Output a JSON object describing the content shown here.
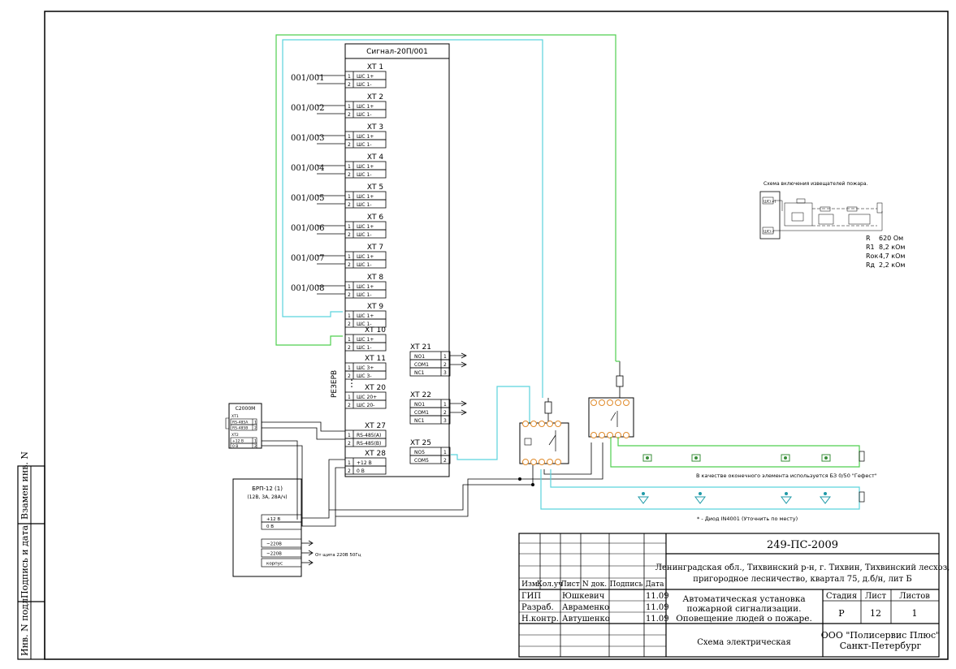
{
  "panel": {
    "title": "Сигнал-20П/001",
    "reserve_label": "РЕЗЕРВ",
    "pin1_label": "1",
    "pin2_label": "2",
    "ellipsis": "⋮",
    "blocks": [
      {
        "header": "ХТ 1",
        "zone": "001/001",
        "labels": [
          "ШС 1+",
          "ШС 1-"
        ]
      },
      {
        "header": "ХТ 2",
        "zone": "001/002",
        "labels": [
          "ШС 1+",
          "ШС 1-"
        ]
      },
      {
        "header": "ХТ 3",
        "zone": "001/003",
        "labels": [
          "ШС 1+",
          "ШС 1-"
        ]
      },
      {
        "header": "ХТ 4",
        "zone": "001/004",
        "labels": [
          "ШС 1+",
          "ШС 1-"
        ]
      },
      {
        "header": "ХТ 5",
        "zone": "001/005",
        "labels": [
          "ШС 1+",
          "ШС 1-"
        ]
      },
      {
        "header": "ХТ 6",
        "zone": "001/006",
        "labels": [
          "ШС 1+",
          "ШС 1-"
        ]
      },
      {
        "header": "ХТ 7",
        "zone": "001/007",
        "labels": [
          "ШС 1+",
          "ШС 1-"
        ]
      },
      {
        "header": "ХТ 8",
        "zone": "001/008",
        "labels": [
          "ШС 1+",
          "ШС 1-"
        ]
      },
      {
        "header": "ХТ 9",
        "zone": "",
        "labels": [
          "ШС 1+",
          "ШС 1-"
        ]
      },
      {
        "header": "ХТ 10",
        "zone": "",
        "labels": [
          "ШС 1+",
          "ШС 1-"
        ]
      },
      {
        "header": "ХТ 11",
        "zone": "",
        "labels": [
          "ШС 3+",
          "ШС 3-"
        ]
      },
      {
        "header": "ХТ 20",
        "zone": "",
        "labels": [
          "ШС 20+",
          "ШС 20-"
        ]
      },
      {
        "header": "ХТ 27",
        "zone": "",
        "labels": [
          "RS-485(А)",
          "RS-485(В)"
        ]
      },
      {
        "header": "ХТ 28",
        "zone": "",
        "labels": [
          "+12 В",
          "0 В"
        ]
      }
    ],
    "relays": [
      {
        "header": "ХТ 21",
        "rows": [
          [
            "NO1",
            "1"
          ],
          [
            "COM1",
            "2"
          ],
          [
            "NC1",
            "3"
          ]
        ]
      },
      {
        "header": "ХТ 22",
        "rows": [
          [
            "NO1",
            "1"
          ],
          [
            "COM1",
            "2"
          ],
          [
            "NC1",
            "3"
          ]
        ]
      },
      {
        "header": "ХТ 25",
        "rows": [
          [
            "NO5",
            "1"
          ],
          [
            "COM5",
            "2"
          ]
        ]
      }
    ]
  },
  "c2000m": {
    "title": "С2000М",
    "xt1": "ХТ1",
    "xt2": "ХТ2",
    "rows1": [
      [
        "RS-485А",
        "1"
      ],
      [
        "RS-485В",
        "2"
      ]
    ],
    "rows2": [
      [
        "+12 В",
        "1"
      ],
      [
        "0 В",
        "2"
      ]
    ]
  },
  "psu": {
    "title": "БРП-12 (1)",
    "subtitle": "(12В, 3А, 28А/ч)",
    "out1": "+12 В",
    "out2": "0 В",
    "in1": "~220В",
    "in2": "~220В",
    "in3": "корпус",
    "mains_note": "От щита 220В 50Гц"
  },
  "notes": {
    "eol": "В качестве оконечного элемента используется БЗ 0/50 \"Гефест\"",
    "diode": "* - Диод IN4001 (Уточнить по месту)"
  },
  "detector_scheme": {
    "title": "Схема включения извещателей пожара.",
    "plus_label": "ШС(+)",
    "minus_label": "ШС(-)",
    "legend": [
      [
        "R",
        "620 Ом"
      ],
      [
        "R1",
        "8,2 кОм"
      ],
      [
        "Rок",
        "4,7 кОм"
      ],
      [
        "Rд",
        "2,2 кОм"
      ]
    ]
  },
  "title_block": {
    "code": "249-ПС-2009",
    "address": "Ленинградская обл., Тихвинский р-н, г. Тихвин, Тихвинский лесхоз, пригородное лесничество, квартал 75, д.б/н, лит Б",
    "headers": [
      "Изм",
      "Кол.уч",
      "Лист",
      "N док.",
      "Подпись",
      "Дата"
    ],
    "people": [
      {
        "role": "ГИП",
        "name": "Юшкевич",
        "date": "11.09"
      },
      {
        "role": "Разраб.",
        "name": "Авраменко",
        "date": "11.09"
      },
      {
        "role": "Н.контр.",
        "name": "Автушенко",
        "date": "11.09"
      }
    ],
    "work_title": "Автоматическая установка пожарной сигнализации. Оповещение людей о пожаре.",
    "stage_label": "Стадия",
    "sheet_label": "Лист",
    "sheets_label": "Листов",
    "stage": "Р",
    "sheet": "12",
    "sheets": "1",
    "drawing": "Схема электрическая",
    "org": "ООО \"Полисервис Плюс\" Санкт-Петербург"
  },
  "side_stamp": {
    "replace_inv": "Взамен инв. N",
    "sign_date": "Подпись и дата",
    "inv_orig": "Инв. N подл."
  }
}
